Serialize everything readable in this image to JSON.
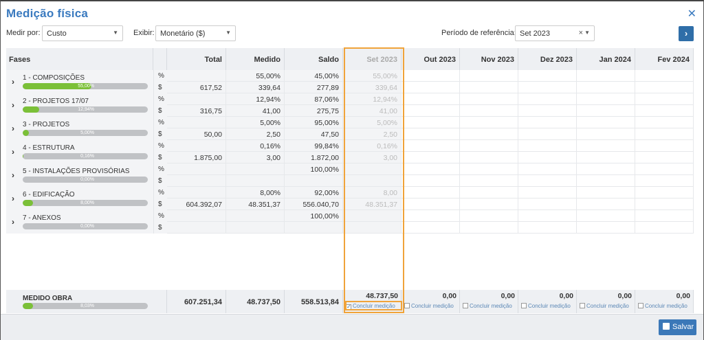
{
  "title": "Medição física",
  "controls": {
    "medir_label": "Medir por:",
    "medir_value": "Custo",
    "exibir_label": "Exibir:",
    "exibir_value": "Monetário ($)",
    "periodo_label": "Período de referência:",
    "periodo_value": "Set 2023"
  },
  "headers": {
    "fases": "Fases",
    "total": "Total",
    "medido": "Medido",
    "saldo": "Saldo",
    "months": [
      "Set 2023",
      "Out 2023",
      "Nov 2023",
      "Dez 2023",
      "Jan 2024",
      "Fev 2024"
    ]
  },
  "units": {
    "pct": "%",
    "money": "$"
  },
  "fases": [
    {
      "name": "1 - COMPOSIÇÕES",
      "progress": 55.0,
      "progress_label": "55,00%",
      "pct": {
        "total": "",
        "medido": "55,00%",
        "saldo": "45,00%",
        "set": "55,00%"
      },
      "money": {
        "total": "617,52",
        "medido": "339,64",
        "saldo": "277,89",
        "set": "339,64"
      }
    },
    {
      "name": "2 - PROJETOS 17/07",
      "progress": 12.94,
      "progress_label": "12,94%",
      "pct": {
        "total": "",
        "medido": "12,94%",
        "saldo": "87,06%",
        "set": "12,94%"
      },
      "money": {
        "total": "316,75",
        "medido": "41,00",
        "saldo": "275,75",
        "set": "41,00"
      }
    },
    {
      "name": "3 - PROJETOS",
      "progress": 5.0,
      "progress_label": "5,00%",
      "pct": {
        "total": "",
        "medido": "5,00%",
        "saldo": "95,00%",
        "set": "5,00%"
      },
      "money": {
        "total": "50,00",
        "medido": "2,50",
        "saldo": "47,50",
        "set": "2,50"
      }
    },
    {
      "name": "4 - ESTRUTURA",
      "progress": 0.16,
      "progress_label": "0,16%",
      "pct": {
        "total": "",
        "medido": "0,16%",
        "saldo": "99,84%",
        "set": "0,16%"
      },
      "money": {
        "total": "1.875,00",
        "medido": "3,00",
        "saldo": "1.872,00",
        "set": "3,00"
      }
    },
    {
      "name": "5 - INSTALAÇÕES PROVISÓRIAS",
      "progress": 0.0,
      "progress_label": "0,00%",
      "pct": {
        "total": "",
        "medido": "",
        "saldo": "100,00%",
        "set": ""
      },
      "money": {
        "total": "",
        "medido": "",
        "saldo": "",
        "set": ""
      }
    },
    {
      "name": "6 - EDIFICAÇÃO",
      "progress": 8.0,
      "progress_label": "8,00%",
      "pct": {
        "total": "",
        "medido": "8,00%",
        "saldo": "92,00%",
        "set": "8,00"
      },
      "money": {
        "total": "604.392,07",
        "medido": "48.351,37",
        "saldo": "556.040,70",
        "set": "48.351,37"
      }
    },
    {
      "name": "7 - ANEXOS",
      "progress": 0.0,
      "progress_label": "0,00%",
      "pct": {
        "total": "",
        "medido": "",
        "saldo": "100,00%",
        "set": ""
      },
      "money": {
        "total": "",
        "medido": "",
        "saldo": "",
        "set": ""
      }
    }
  ],
  "footer": {
    "name": "MEDIDO OBRA",
    "progress": 8.03,
    "progress_label": "8,03%",
    "total": "607.251,34",
    "medido": "48.737,50",
    "saldo": "558.513,84",
    "month_values": [
      "48.737,50",
      "0,00",
      "0,00",
      "0,00",
      "0,00",
      "0,00"
    ],
    "month_checked": [
      true,
      false,
      false,
      false,
      false,
      false
    ],
    "concluir_label": "Concluir medição"
  },
  "save_label": "Salvar",
  "colors": {
    "accent": "#3a7abf",
    "progress": "#7bc038",
    "highlight": "#f0a33a"
  }
}
